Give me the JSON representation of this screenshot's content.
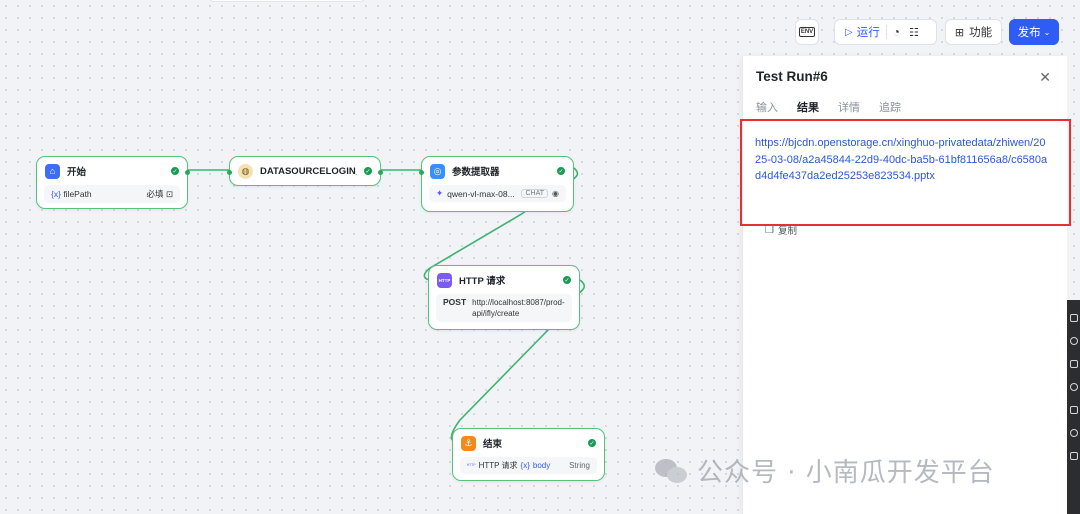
{
  "toolbar": {
    "env_label": "ENV",
    "run_label": "运行",
    "func_label": "功能",
    "publish_label": "发布"
  },
  "nodes": {
    "start": {
      "title": "开始",
      "param_prefix": "{x}",
      "param": "filePath",
      "required": "必填"
    },
    "datasource": {
      "title": "DATASOURCELOGIN_POS"
    },
    "extractor": {
      "title": "参数提取器",
      "model": "qwen-vl-max-08...",
      "badge": "CHAT"
    },
    "http": {
      "title": "HTTP 请求",
      "method": "POST",
      "url": "http://localhost:8087/prod-api/ifly/create",
      "icon_text": "HTTP"
    },
    "end": {
      "title": "结束",
      "source": "HTTP 请求",
      "var_prefix": "{x}",
      "var": "body",
      "type": "String"
    }
  },
  "panel": {
    "title": "Test Run#6",
    "tabs": [
      {
        "label": "输入"
      },
      {
        "label": "结果"
      },
      {
        "label": "详情"
      },
      {
        "label": "追踪"
      }
    ],
    "active_tab": "结果",
    "result": "https://bjcdn.openstorage.cn/xinghuo-privatedata/zhiwen/2025-03-08/a2a45844-22d9-40dc-ba5b-61bf811656a8/c6580ad4d4fe437da2ed25253e823534.pptx",
    "copy_label": "复制"
  },
  "watermark": "公众号 · 小南瓜开发平台",
  "colors": {
    "accent": "#2f5cf5",
    "success": "#1a9b52",
    "edge": "#3cb371",
    "highlight": "#e8302f"
  }
}
